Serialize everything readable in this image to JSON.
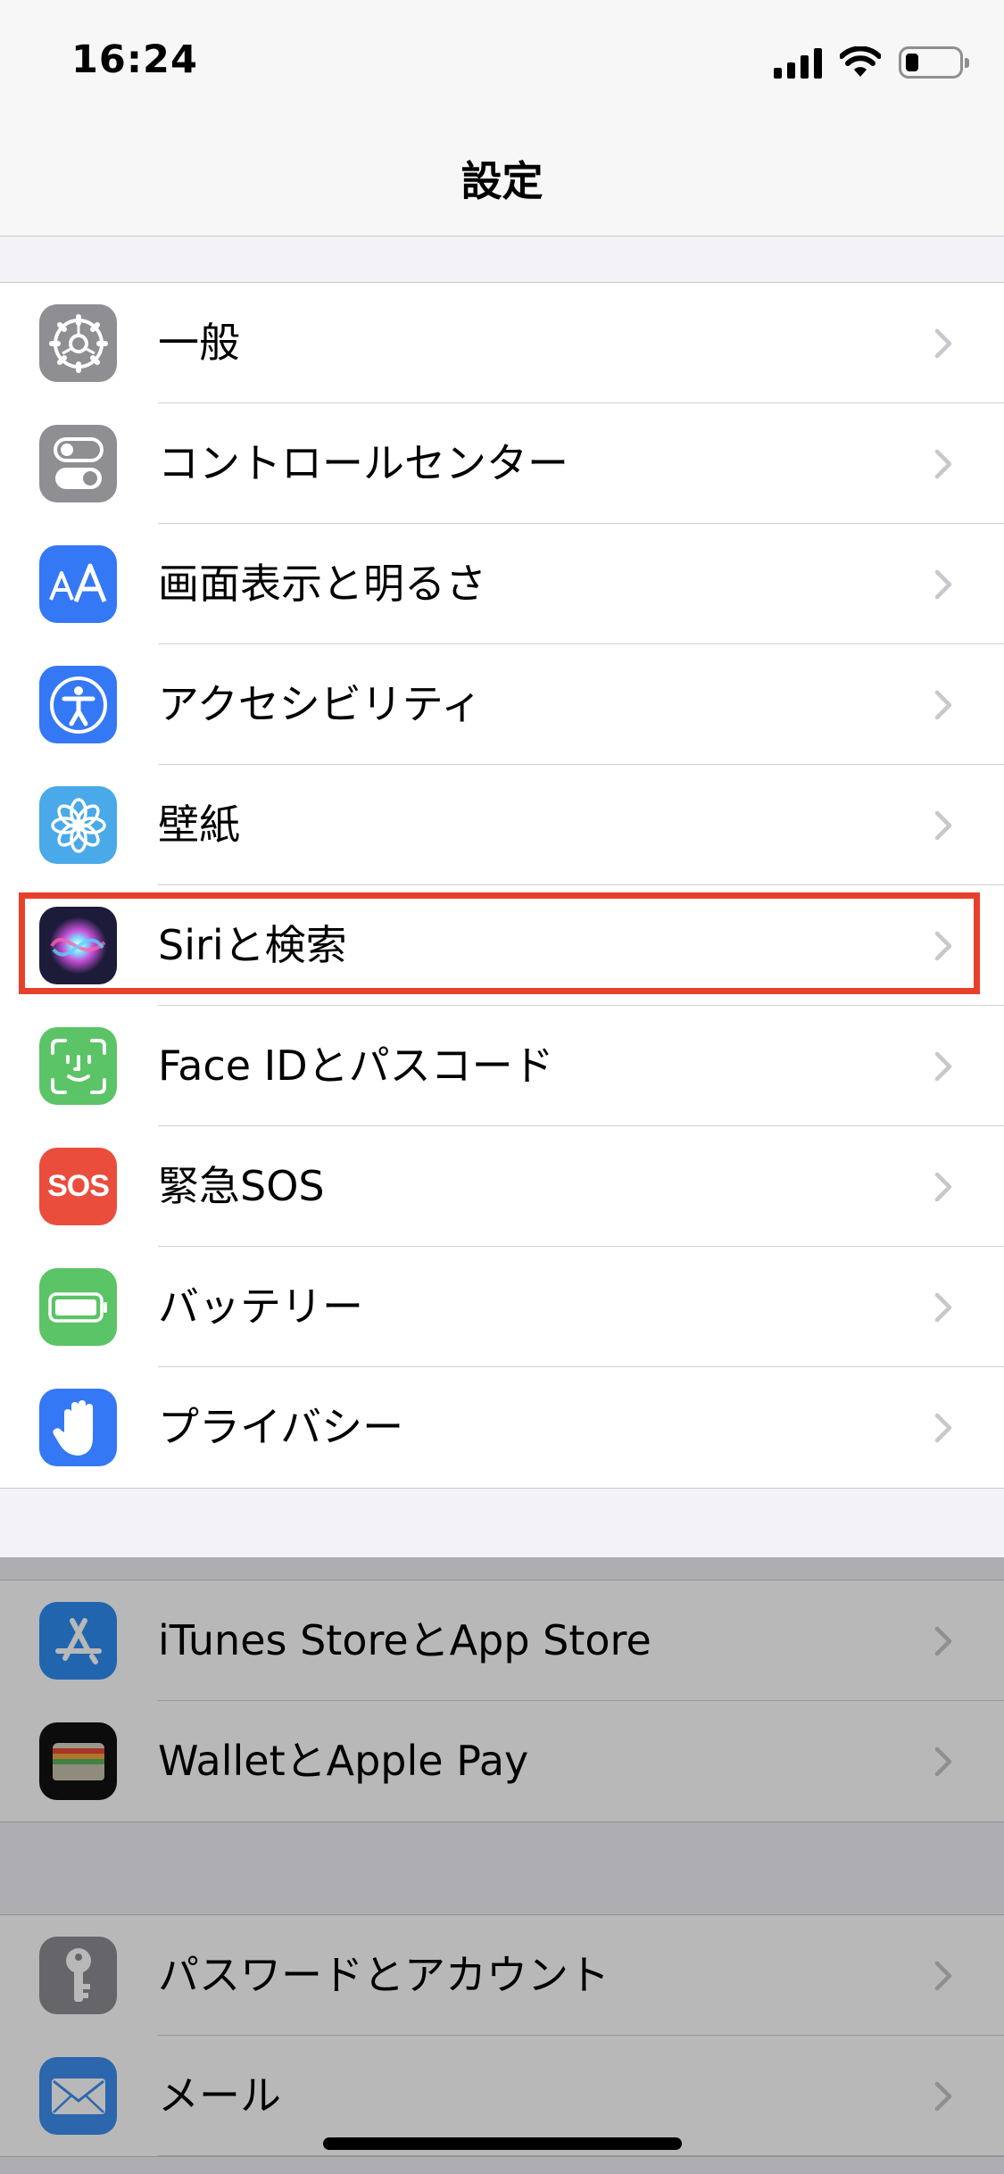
{
  "status_bar": {
    "time": "16:24",
    "icons": [
      "cellular-signal-icon",
      "wifi-icon",
      "battery-icon"
    ],
    "battery_level": 0.25
  },
  "nav": {
    "title": "設定"
  },
  "groups": [
    {
      "items": [
        {
          "label": "一般",
          "icon": "gear-icon",
          "icon_bg": "#8e8e93"
        },
        {
          "label": "コントロールセンター",
          "icon": "toggles-icon",
          "icon_bg": "#8e8e93"
        },
        {
          "label": "画面表示と明るさ",
          "icon": "text-size-icon",
          "icon_bg": "#3478f6"
        },
        {
          "label": "アクセシビリティ",
          "icon": "accessibility-icon",
          "icon_bg": "#3478f6"
        },
        {
          "label": "壁紙",
          "icon": "flower-icon",
          "icon_bg": "#4aa9e8"
        },
        {
          "label": "Siriと検索",
          "icon": "siri-icon",
          "icon_bg": "#1c1c3a",
          "highlighted": true
        },
        {
          "label": "Face IDとパスコード",
          "icon": "face-id-icon",
          "icon_bg": "#5bc466"
        },
        {
          "label": "緊急SOS",
          "icon": "sos-icon",
          "icon_bg": "#eb4d3d",
          "icon_text": "SOS"
        },
        {
          "label": "バッテリー",
          "icon": "battery-setting-icon",
          "icon_bg": "#5bc466"
        },
        {
          "label": "プライバシー",
          "icon": "hand-icon",
          "icon_bg": "#3478f6"
        }
      ]
    },
    {
      "items": [
        {
          "label": "iTunes StoreとApp Store",
          "icon": "app-store-icon",
          "icon_bg": "#2f8cf3"
        },
        {
          "label": "WalletとApple Pay",
          "icon": "wallet-icon",
          "icon_bg": "#111111"
        }
      ]
    },
    {
      "items": [
        {
          "label": "パスワードとアカウント",
          "icon": "key-icon",
          "icon_bg": "#8e8e93"
        },
        {
          "label": "メール",
          "icon": "mail-icon",
          "icon_bg": "#3d8ef0"
        }
      ]
    }
  ],
  "colors": {
    "highlight_border": "#e8402b",
    "chevron": "#c7c7cc",
    "separator": "#d1d1d6"
  }
}
